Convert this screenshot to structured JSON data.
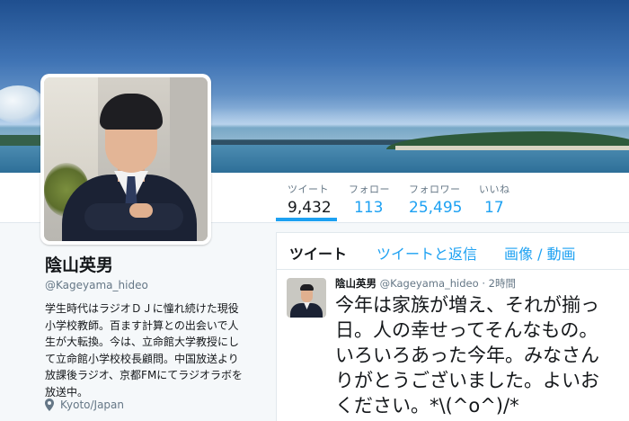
{
  "profile": {
    "name": "陰山英男",
    "handle": "@Kageyama_hideo",
    "bio_lines": [
      "学生時代はラジオＤＪに憧れ続けた現役",
      "小学校教師。百ます計算との出会いで人",
      "生が大転換。今は、立命館大学教授にし",
      "て立命館小学校校長顧問。中国放送より",
      "放課後ラジオ、京都FMにてラジオラボを",
      "放送中。"
    ],
    "location": "Kyoto/Japan"
  },
  "nav": [
    {
      "label": "ツイート",
      "value": "9,432",
      "active": true
    },
    {
      "label": "フォロー",
      "value": "113",
      "active": false
    },
    {
      "label": "フォロワー",
      "value": "25,495",
      "active": false
    },
    {
      "label": "いいね",
      "value": "17",
      "active": false
    }
  ],
  "tabs": [
    {
      "label": "ツイート",
      "active": true
    },
    {
      "label": "ツイートと返信",
      "active": false
    },
    {
      "label": "画像 / 動画",
      "active": false
    }
  ],
  "tweet": {
    "name": "陰山英男",
    "handle": "@Kageyama_hideo",
    "time": "2時間",
    "text_lines": [
      "今年は家族が増え、それが揃っ",
      "日。人の幸せってそんなもの。",
      "いろいろあった今年。みなさん",
      "りがとうございました。よいお",
      "ください。*\\(^o^)/*"
    ]
  },
  "colors": {
    "accent": "#1da1f2",
    "text_primary": "#14171a",
    "text_secondary": "#657786"
  },
  "icons": {
    "location": "map-pin-icon"
  }
}
